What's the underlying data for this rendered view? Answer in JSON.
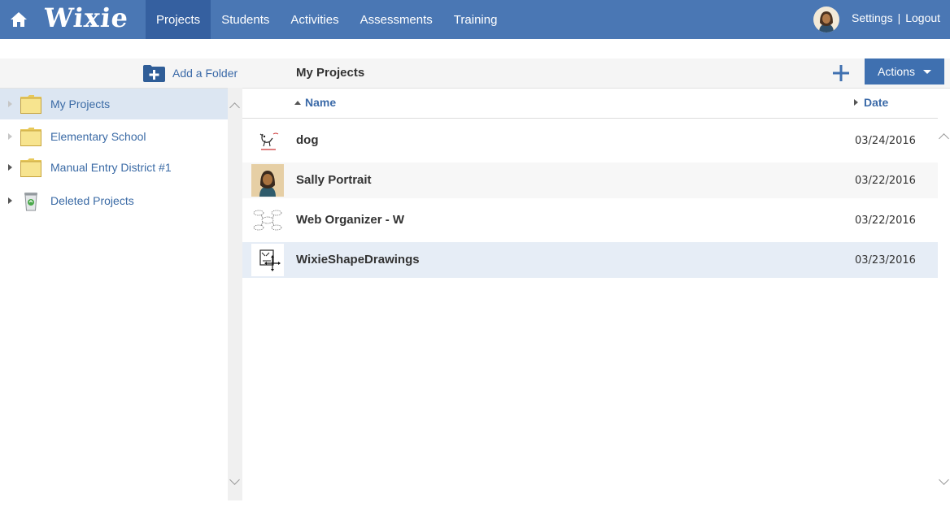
{
  "app": {
    "logo": "Wixie"
  },
  "nav": {
    "items": [
      {
        "label": "Projects",
        "active": true
      },
      {
        "label": "Students"
      },
      {
        "label": "Activities"
      },
      {
        "label": "Assessments"
      },
      {
        "label": "Training"
      }
    ]
  },
  "user": {
    "settings_label": "Settings",
    "separator": "|",
    "logout_label": "Logout"
  },
  "toolbar": {
    "add_folder_label": "Add a Folder",
    "page_title": "My Projects",
    "actions_label": "Actions"
  },
  "sidebar": {
    "folders": [
      {
        "label": "My Projects",
        "icon": "folder-icon",
        "selected": true,
        "expandable": false
      },
      {
        "label": "Elementary School",
        "icon": "folder-icon",
        "expandable": false
      },
      {
        "label": "Manual Entry District #1",
        "icon": "folder-icon",
        "expandable": true
      },
      {
        "label": "Deleted Projects",
        "icon": "trash-icon",
        "expandable": true
      }
    ]
  },
  "table": {
    "columns": {
      "name": "Name",
      "date": "Date"
    },
    "sort": {
      "column": "name",
      "direction": "ascending"
    },
    "rows": [
      {
        "name": "dog",
        "date": "03/24/2016",
        "thumb": "dog-drawing-thumbnail"
      },
      {
        "name": "Sally Portrait",
        "date": "03/22/2016",
        "thumb": "portrait-thumbnail"
      },
      {
        "name": "Web Organizer - W",
        "date": "03/22/2016",
        "thumb": "web-organizer-thumbnail"
      },
      {
        "name": "WixieShapeDrawings",
        "date": "03/23/2016",
        "thumb": "shape-drawing-thumbnail",
        "selected": true
      }
    ]
  },
  "colors": {
    "nav_bg": "#4a77b4",
    "nav_active": "#3560a0",
    "link": "#3b6aa8",
    "button": "#3f70b0",
    "selected_folder": "#dce6f2",
    "selected_row": "#e6edf6"
  }
}
